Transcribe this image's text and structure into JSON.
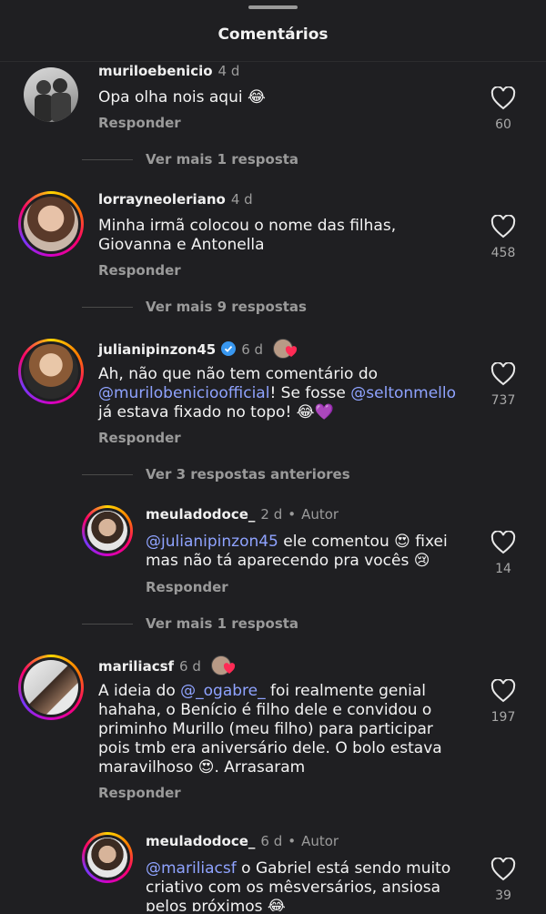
{
  "header": {
    "title": "Comentários"
  },
  "comments": [
    {
      "username": "muriloebenicio",
      "time": "4 d",
      "text": "Opa olha nois aqui 😂",
      "reply_label": "Responder",
      "likes": "60",
      "more_replies": "Ver mais 1 resposta"
    },
    {
      "username": "lorrayneoleriano",
      "time": "4 d",
      "text_line1": "Minha irmã colocou o nome das filhas,",
      "text_line2": "Giovanna e Antonella",
      "reply_label": "Responder",
      "likes": "458",
      "more_replies": "Ver mais 9 respostas"
    },
    {
      "username": "julianipinzon45",
      "time": "6 d",
      "text_line1": "Ah, não que não tem comentário do",
      "mention1": "@murilobenicioofficial",
      "text_mid": "! Se fosse ",
      "mention2": "@seltonmello",
      "text_line3": "já estava fixado no topo! 😂💜",
      "reply_label": "Responder",
      "likes": "737",
      "more_replies": "Ver 3 respostas anteriores"
    },
    {
      "username": "meuladodoce_",
      "time": "2 d",
      "badge": "Autor",
      "mention": "@julianipinzon45",
      "text_line1_rest": " ele comentou 😍  fixei",
      "text_line2": "mas não tá aparecendo pra vocês 😢",
      "reply_label": "Responder",
      "likes": "14",
      "more_replies": "Ver mais 1 resposta"
    },
    {
      "username": "mariliacsf",
      "time": "6 d",
      "text_pre": "A ideia do ",
      "mention": "@_ogabre_",
      "text_line1_rest": "  foi realmente genial",
      "text_line2": "hahaha, o Benício é filho dele e convidou o",
      "text_line3": "priminho Murillo (meu filho) para participar",
      "text_line4": "pois tmb era aniversário dele. O bolo estava",
      "text_line5": "maravilhoso 😍. Arrasaram",
      "reply_label": "Responder",
      "likes": "197"
    },
    {
      "username": "meuladodoce_",
      "time": "6 d",
      "badge": "Autor",
      "mention": "@mariliacsf",
      "text_line1_rest": " o Gabriel está sendo muito",
      "text_line2": "criativo com os mêsversários, ansiosa",
      "text_line3": "pelos próximos 😂",
      "likes": "39"
    }
  ],
  "colors": {
    "background": "#1f1f22",
    "mention": "#8fa3ff",
    "muted": "#9a9a9a"
  }
}
